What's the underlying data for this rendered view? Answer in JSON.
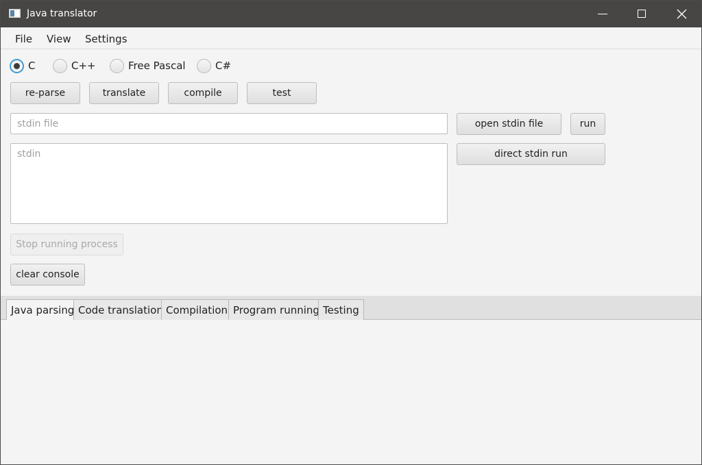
{
  "window": {
    "title": "Java translator",
    "icons": {
      "app": "app-icon",
      "minimize": "minimize-icon",
      "maximize": "maximize-icon",
      "close": "close-icon"
    }
  },
  "menu": {
    "items": [
      "File",
      "View",
      "Settings"
    ]
  },
  "languages": {
    "selected": "C",
    "options": [
      "C",
      "C++",
      "Free Pascal",
      "C#"
    ]
  },
  "actions": {
    "reparse": "re-parse",
    "translate": "translate",
    "compile": "compile",
    "test": "test"
  },
  "stdin": {
    "file_placeholder": "stdin file",
    "file_value": "",
    "open_label": "open stdin file",
    "run_label": "run",
    "text_placeholder": "stdin",
    "text_value": "",
    "direct_run_label": "direct stdin run"
  },
  "process": {
    "stop_label": "Stop running process",
    "stop_enabled": false,
    "clear_label": "clear console"
  },
  "tabs": {
    "active": "Java parsing",
    "items": [
      "Java parsing",
      "Code translation",
      "Compilation",
      "Program running",
      "Testing"
    ]
  },
  "colors": {
    "titlebar": "#474645",
    "accent": "#3d9bd3",
    "background": "#f4f4f4"
  }
}
